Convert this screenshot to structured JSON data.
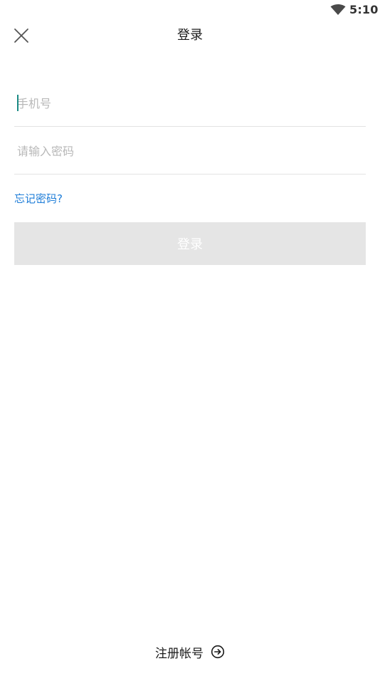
{
  "status_bar": {
    "time": "5:10",
    "wifi_icon": "wifi-icon"
  },
  "header": {
    "title": "登录",
    "close_icon": "close-icon"
  },
  "form": {
    "phone_placeholder": "手机号",
    "phone_value": "",
    "password_placeholder": "请输入密码",
    "password_value": "",
    "forgot_label": "忘记密码?",
    "login_label": "登录"
  },
  "footer": {
    "register_label": "注册帐号",
    "register_icon": "arrow-right-circle-icon"
  },
  "colors": {
    "accent_link": "#1e7dd8",
    "button_disabled": "#e5e5e5",
    "cursor": "#1a8a84",
    "divider": "#e3e3e3"
  }
}
